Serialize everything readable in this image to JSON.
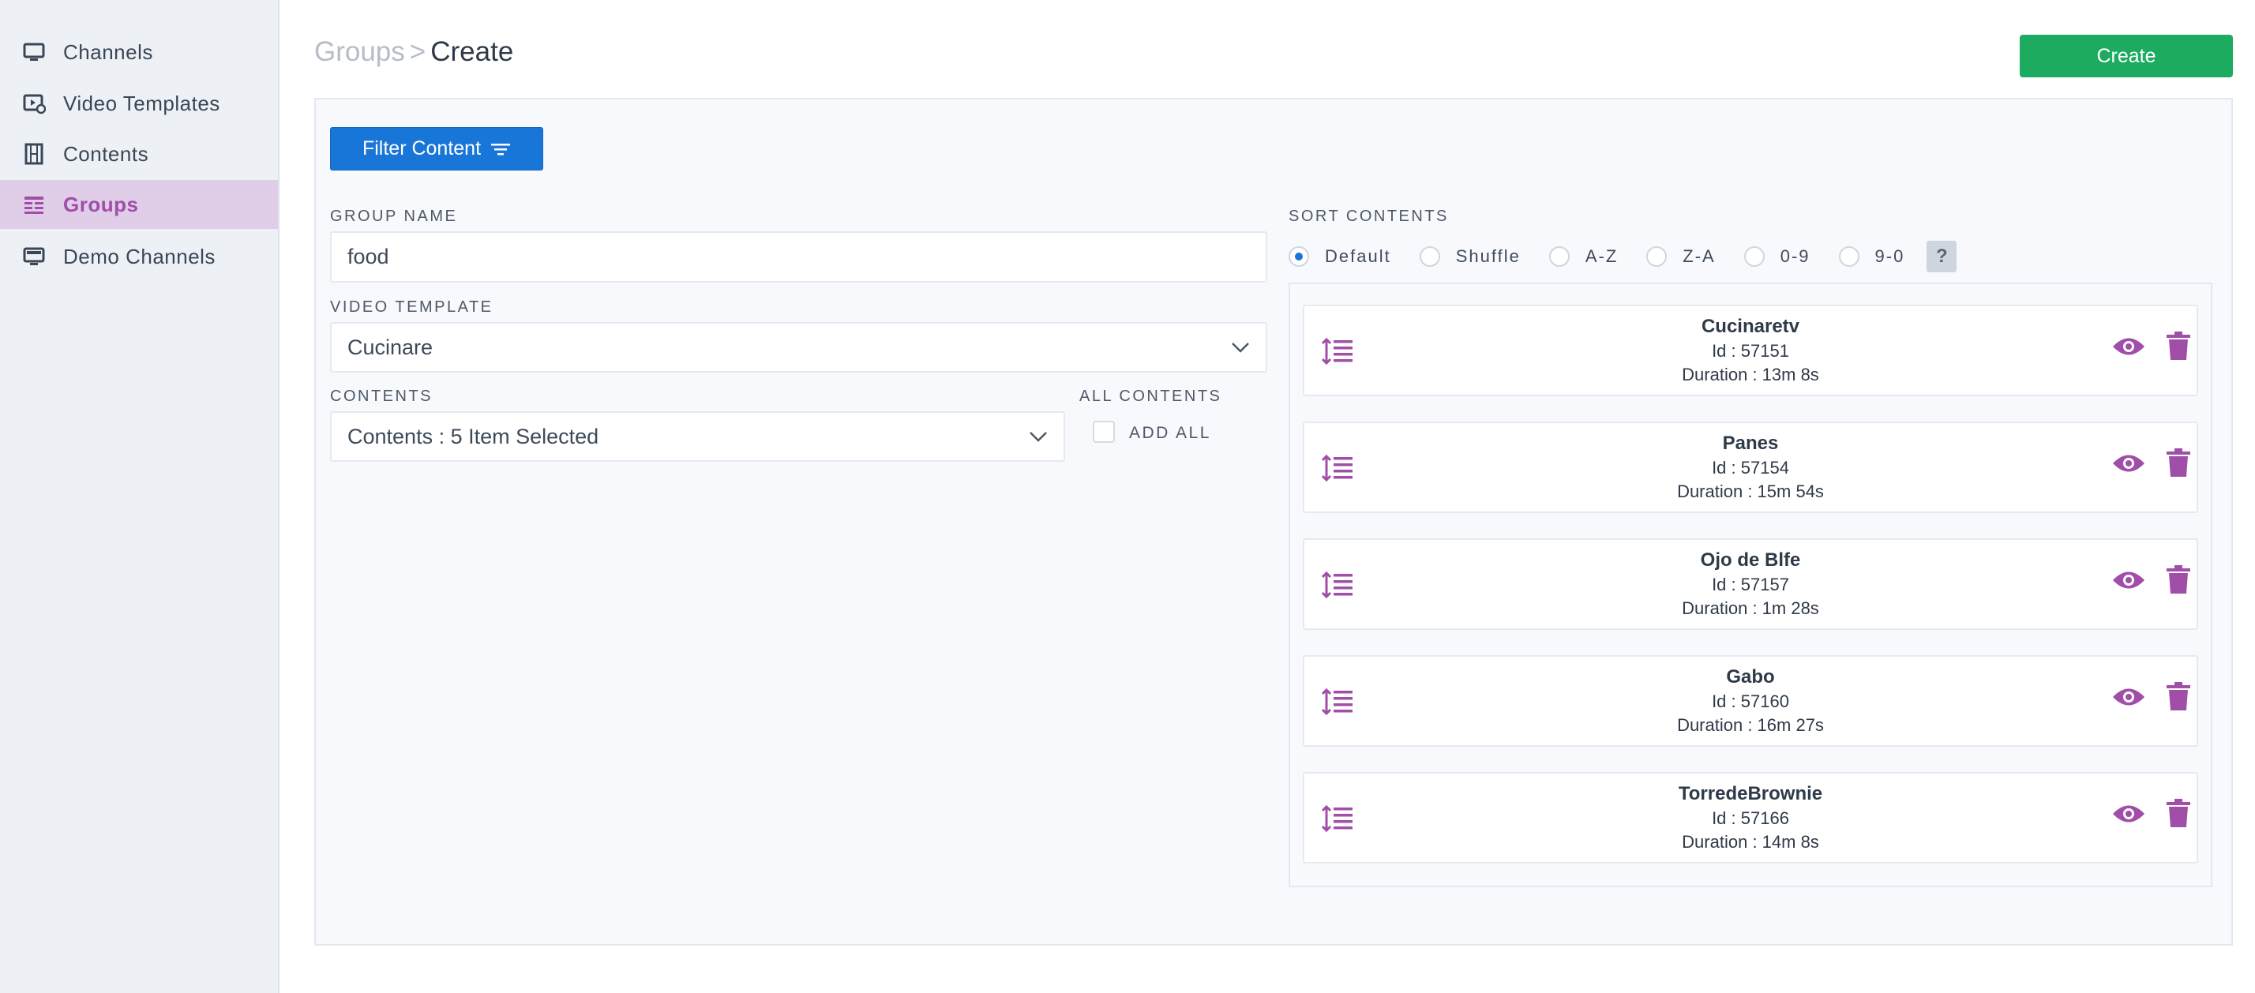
{
  "sidebar": {
    "items": [
      {
        "label": "Channels",
        "icon": "monitor-icon"
      },
      {
        "label": "Video Templates",
        "icon": "video-template-icon"
      },
      {
        "label": "Contents",
        "icon": "film-icon"
      },
      {
        "label": "Groups",
        "icon": "groups-icon",
        "active": true
      },
      {
        "label": "Demo Channels",
        "icon": "demo-channels-icon"
      }
    ]
  },
  "header": {
    "breadcrumb_parent": "Groups",
    "breadcrumb_sep": ">",
    "breadcrumb_current": "Create",
    "create_label": "Create"
  },
  "form": {
    "filter_label": "Filter Content",
    "group_name_label": "GROUP NAME",
    "group_name_value": "food",
    "video_template_label": "VIDEO TEMPLATE",
    "video_template_value": "Cucinare",
    "contents_label": "CONTENTS",
    "contents_value": "Contents : 5 Item Selected",
    "all_contents_label": "ALL CONTENTS",
    "add_all_label": "ADD ALL"
  },
  "sort": {
    "label": "SORT CONTENTS",
    "options": [
      "Default",
      "Shuffle",
      "A-Z",
      "Z-A",
      "0-9",
      "9-0"
    ],
    "selected": "Default",
    "help": "?"
  },
  "items": [
    {
      "title": "Cucinaretv",
      "id": "Id : 57151",
      "duration": "Duration : 13m 8s"
    },
    {
      "title": "Panes",
      "id": "Id : 57154",
      "duration": "Duration : 15m 54s"
    },
    {
      "title": "Ojo de Blfe",
      "id": "Id : 57157",
      "duration": "Duration : 1m 28s"
    },
    {
      "title": "Gabo",
      "id": "Id : 57160",
      "duration": "Duration : 16m 27s"
    },
    {
      "title": "TorredeBrownie",
      "id": "Id : 57166",
      "duration": "Duration : 14m 8s"
    }
  ],
  "colors": {
    "accent": "#a04ea8",
    "primary": "#1976d9",
    "success": "#1dab5f"
  }
}
